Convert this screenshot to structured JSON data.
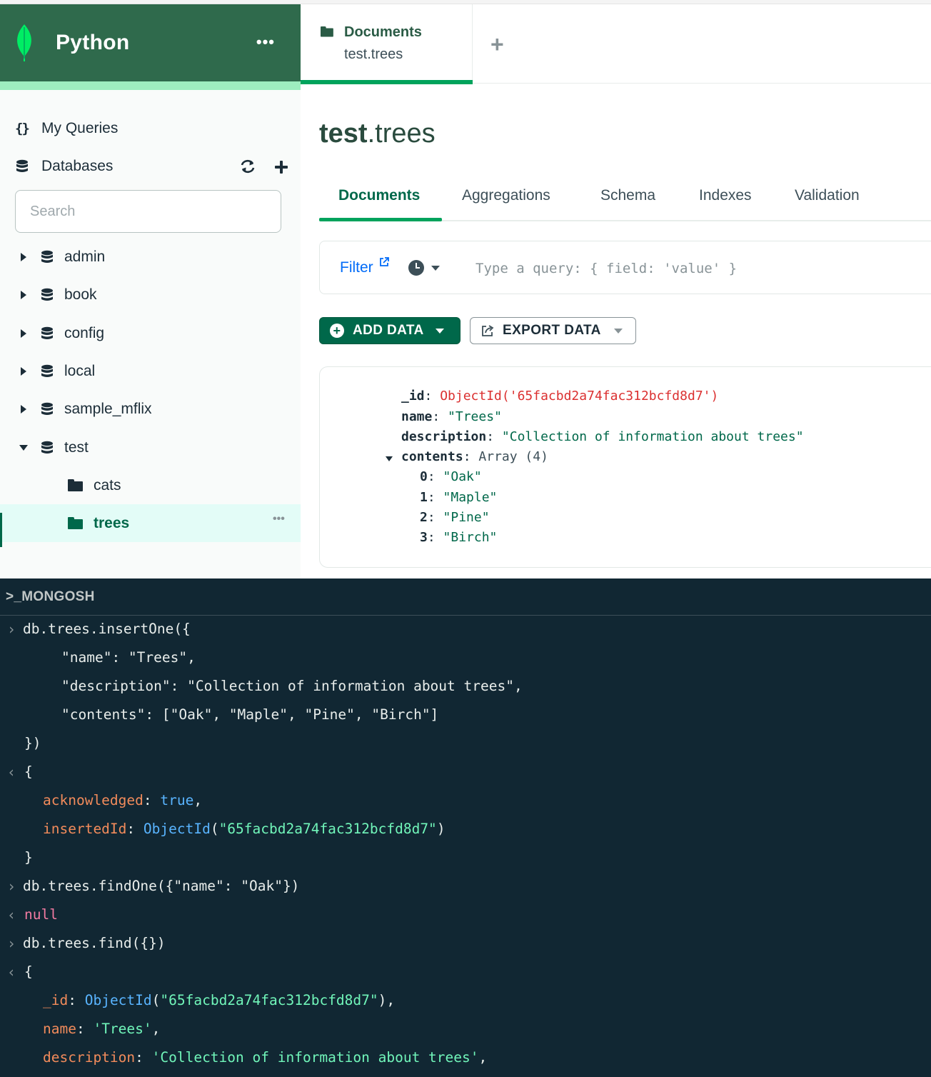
{
  "app": {
    "connection_name": "Python"
  },
  "colors": {
    "brand_green": "#00684a",
    "header_green": "#2f6a4c",
    "accent_mint": "#9eedbf",
    "shell_bg": "#112733"
  },
  "sidebar": {
    "my_queries": "My Queries",
    "databases": "Databases",
    "search_placeholder": "Search",
    "databases_list": [
      {
        "label": "admin",
        "expanded": false
      },
      {
        "label": "book",
        "expanded": false
      },
      {
        "label": "config",
        "expanded": false
      },
      {
        "label": "local",
        "expanded": false
      },
      {
        "label": "sample_mflix",
        "expanded": false
      },
      {
        "label": "test",
        "expanded": true
      }
    ],
    "collections": [
      {
        "label": "cats",
        "selected": false
      },
      {
        "label": "trees",
        "selected": true
      }
    ]
  },
  "tabs": {
    "active": {
      "title": "Documents",
      "subtitle": "test.trees"
    }
  },
  "namespace": {
    "db": "test",
    "dot_collection": ".trees"
  },
  "subtabs": [
    "Documents",
    "Aggregations",
    "Schema",
    "Indexes",
    "Validation"
  ],
  "filter": {
    "label": "Filter",
    "placeholder": "Type a query: { field: 'value' }"
  },
  "buttons": {
    "add_data": "ADD DATA",
    "export_data": "EXPORT DATA"
  },
  "document": {
    "id_key": "_id",
    "id_value": "ObjectId('65facbd2a74fac312bcfd8d7')",
    "name_key": "name",
    "name_value": "\"Trees\"",
    "desc_key": "description",
    "desc_value": "\"Collection of information about trees\"",
    "contents_key": "contents",
    "contents_type": "Array (4)",
    "items": [
      {
        "index": "0",
        "value": "\"Oak\""
      },
      {
        "index": "1",
        "value": "\"Maple\""
      },
      {
        "index": "2",
        "value": "\"Pine\""
      },
      {
        "index": "3",
        "value": "\"Birch\""
      }
    ]
  },
  "shell": {
    "title": ">_MONGOSH",
    "l1": "db.trees.insertOne({",
    "l2": "\"name\": \"Trees\",",
    "l3": "\"description\": \"Collection of information about trees\",",
    "l4": "\"contents\": [\"Oak\", \"Maple\", \"Pine\", \"Birch\"]",
    "l5": "})",
    "brace_open": "{",
    "ack_key": "acknowledged",
    "ack_val": "true",
    "ins_key": "insertedId",
    "objectid_fn": "ObjectId",
    "ins_val": "\"65facbd2a74fac312bcfd8d7\"",
    "brace_close": "}",
    "l10": "db.trees.findOne({\"name\": \"Oak\"})",
    "null_val": "null",
    "l12": "db.trees.find({})",
    "id_key": "_id",
    "id_val": "\"65facbd2a74fac312bcfd8d7\"",
    "name_key": "name",
    "name_val": "'Trees'",
    "desc_key": "description",
    "desc_val": "'Collection of information about trees'"
  }
}
